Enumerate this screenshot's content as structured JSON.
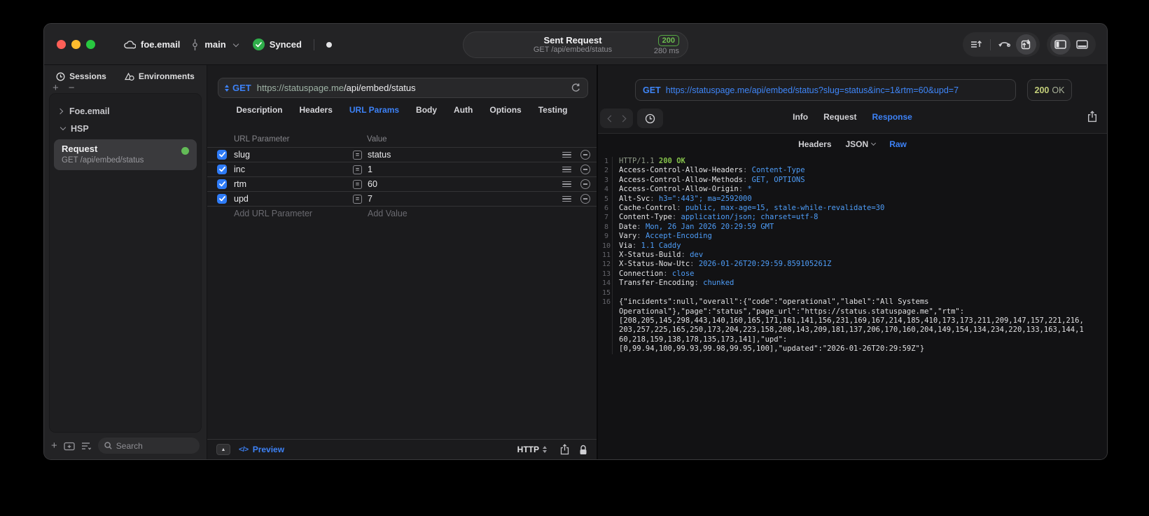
{
  "titlebar": {
    "project": "foe.email",
    "branch": "main",
    "sync_label": "Synced",
    "request_title": "Sent Request",
    "request_subtitle": "GET /api/embed/status",
    "status_badge": "200",
    "duration": "280 ms"
  },
  "sidebar": {
    "tabs": [
      {
        "label": "Sessions"
      },
      {
        "label": "Environments"
      }
    ],
    "tree": [
      {
        "label": "Foe.email",
        "expanded": false
      },
      {
        "label": "HSP",
        "expanded": true
      }
    ],
    "request_item": {
      "title": "Request",
      "subtitle": "GET /api/embed/status",
      "status_color": "#63bb57"
    },
    "search_placeholder": "Search"
  },
  "request_editor": {
    "method": "GET",
    "url_host": "https://statuspage.me",
    "url_path": "/api/embed/status",
    "tabs": [
      "Description",
      "Headers",
      "URL Params",
      "Body",
      "Auth",
      "Options",
      "Testing"
    ],
    "active_tab": "URL Params",
    "params": {
      "columns": [
        "URL Parameter",
        "Value"
      ],
      "rows": [
        {
          "name": "slug",
          "value": "status",
          "checked": true
        },
        {
          "name": "inc",
          "value": "1",
          "checked": true
        },
        {
          "name": "rtm",
          "value": "60",
          "checked": true
        },
        {
          "name": "upd",
          "value": "7",
          "checked": true
        }
      ],
      "add_param_placeholder": "Add URL Parameter",
      "add_value_placeholder": "Add Value"
    },
    "footer": {
      "preview_label": "Preview",
      "code_glyph": "</>",
      "protocol_label": "HTTP"
    }
  },
  "response_viewer": {
    "method": "GET",
    "url": "https://statuspage.me/api/embed/status?slug=status&inc=1&rtm=60&upd=7",
    "status_code": "200",
    "status_text": "OK",
    "tabs": [
      "Info",
      "Request",
      "Response"
    ],
    "active_tab": "Response",
    "subtabs": [
      "Headers",
      "JSON",
      "Raw"
    ],
    "active_subtab": "Raw",
    "lines": [
      {
        "n": 1,
        "type": "status",
        "version": "HTTP/1.1",
        "status": "200 OK"
      },
      {
        "n": 2,
        "type": "header",
        "name": "Access-Control-Allow-Headers",
        "value": "Content-Type"
      },
      {
        "n": 3,
        "type": "header",
        "name": "Access-Control-Allow-Methods",
        "value": "GET, OPTIONS"
      },
      {
        "n": 4,
        "type": "header",
        "name": "Access-Control-Allow-Origin",
        "value": "*"
      },
      {
        "n": 5,
        "type": "header",
        "name": "Alt-Svc",
        "value": "h3=\":443\"; ma=2592000"
      },
      {
        "n": 6,
        "type": "header",
        "name": "Cache-Control",
        "value": "public, max-age=15, stale-while-revalidate=30"
      },
      {
        "n": 7,
        "type": "header",
        "name": "Content-Type",
        "value": "application/json; charset=utf-8"
      },
      {
        "n": 8,
        "type": "header",
        "name": "Date",
        "value": "Mon, 26 Jan 2026 20:29:59 GMT"
      },
      {
        "n": 9,
        "type": "header",
        "name": "Vary",
        "value": "Accept-Encoding"
      },
      {
        "n": 10,
        "type": "header",
        "name": "Via",
        "value": "1.1 Caddy"
      },
      {
        "n": 11,
        "type": "header",
        "name": "X-Status-Build",
        "value": "dev"
      },
      {
        "n": 12,
        "type": "header",
        "name": "X-Status-Now-Utc",
        "value": "2026-01-26T20:29:59.859105261Z"
      },
      {
        "n": 13,
        "type": "header",
        "name": "Connection",
        "value": "close"
      },
      {
        "n": 14,
        "type": "header",
        "name": "Transfer-Encoding",
        "value": "chunked"
      },
      {
        "n": 15,
        "type": "blank"
      },
      {
        "n": 16,
        "type": "json",
        "rows": [
          "{\"incidents\":null,\"overall\":{\"code\":\"operational\",\"label\":\"All Systems",
          "Operational\"},\"page\":\"status\",\"page_url\":\"https://status.statuspage.me\",\"rtm\":",
          "[208,205,145,298,443,140,160,165,171,161,141,156,231,169,167,214,185,410,173,173,211,209,147,157,221,216,",
          "203,257,225,165,250,173,204,223,158,208,143,209,181,137,206,170,160,204,149,154,134,234,220,133,163,144,1",
          "60,218,159,138,178,135,173,141],\"upd\":",
          "[0,99.94,100,99.93,99.98,99.95,100],\"updated\":\"2026-01-26T20:29:59Z\"}"
        ]
      }
    ]
  },
  "colors": {
    "accent_blue": "#3d82f7",
    "value_blue": "#4e9df8",
    "status_green": "#84c14a",
    "sync_green": "#2fae4a",
    "dot_green": "#63bb57",
    "badge_yellow_green": "#c3cf7a",
    "traffic_red": "#ff5f57",
    "traffic_yellow": "#febc2e",
    "traffic_green": "#28c840"
  }
}
